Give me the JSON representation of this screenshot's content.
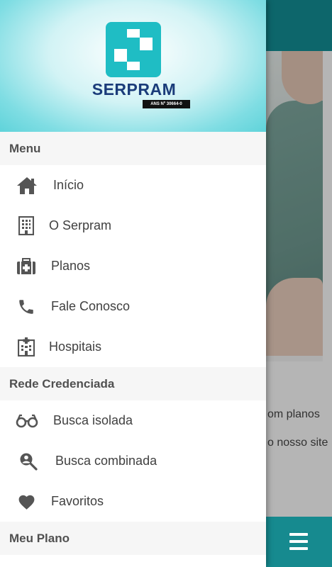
{
  "brand": {
    "name": "SERPRAM",
    "registration": "ANS Nº 30664-0"
  },
  "drawer": {
    "sections": [
      {
        "title": "Menu",
        "items": [
          {
            "label": "Início",
            "icon": "home-icon"
          },
          {
            "label": "O Serpram",
            "icon": "building-icon"
          },
          {
            "label": "Planos",
            "icon": "medical-bag-icon"
          },
          {
            "label": "Fale Conosco",
            "icon": "phone-icon"
          },
          {
            "label": "Hospitais",
            "icon": "hospital-building-icon"
          }
        ]
      },
      {
        "title": "Rede Credenciada",
        "items": [
          {
            "label": "Busca isolada",
            "icon": "glasses-icon"
          },
          {
            "label": "Busca combinada",
            "icon": "person-search-icon"
          },
          {
            "label": "Favoritos",
            "icon": "heart-icon"
          }
        ]
      },
      {
        "title": "Meu Plano",
        "items": []
      }
    ]
  },
  "background": {
    "text_line_1": "om   planos",
    "text_line_2": "o nosso site"
  },
  "colors": {
    "topbar": "#138e95",
    "accent": "#1fbfc6",
    "brand_text": "#1b3c7a"
  }
}
